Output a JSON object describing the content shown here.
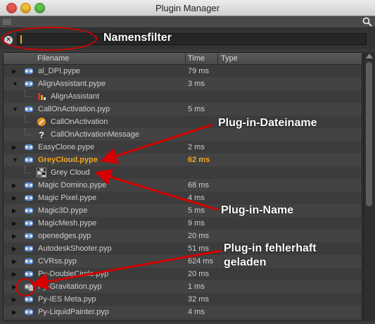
{
  "window": {
    "title": "Plugin Manager"
  },
  "filter": {
    "value": "",
    "placeholder": ""
  },
  "columns": {
    "filename": "Filename",
    "time": "Time",
    "type": "Type"
  },
  "rows": [
    {
      "name": "al_DPI.pype",
      "time": "79 ms",
      "level": 0,
      "expander": "collapsed",
      "icon": "python-file-icon"
    },
    {
      "name": "AlignAssistant.pype",
      "time": "3 ms",
      "level": 0,
      "expander": "expanded",
      "icon": "python-file-icon"
    },
    {
      "name": "AlignAssistant",
      "time": "",
      "level": 1,
      "expander": "none",
      "icon": "align-tool-icon"
    },
    {
      "name": "CallOnActivation.pyp",
      "time": "5 ms",
      "level": 0,
      "expander": "expanded",
      "icon": "python-file-icon"
    },
    {
      "name": "CallOnActivation",
      "time": "",
      "level": 1,
      "expander": "none",
      "icon": "plugin-pen-icon"
    },
    {
      "name": "CallOnActivationMessage",
      "time": "",
      "level": 1,
      "expander": "none",
      "icon": "question-mark-icon"
    },
    {
      "name": "EasyClone.pype",
      "time": "2 ms",
      "level": 0,
      "expander": "collapsed",
      "icon": "python-file-icon"
    },
    {
      "name": "GreyCloud.pype",
      "time": "62 ms",
      "level": 0,
      "expander": "expanded",
      "icon": "python-file-icon",
      "selected": true
    },
    {
      "name": "Grey Cloud",
      "time": "",
      "level": 1,
      "expander": "none",
      "icon": "noise-texture-icon"
    },
    {
      "name": "Magic Domino.pype",
      "time": "68 ms",
      "level": 0,
      "expander": "collapsed",
      "icon": "python-file-icon"
    },
    {
      "name": "Magic Pixel.pype",
      "time": "4 ms",
      "level": 0,
      "expander": "collapsed",
      "icon": "python-file-icon"
    },
    {
      "name": "Magic3D.pype",
      "time": "5 ms",
      "level": 0,
      "expander": "collapsed",
      "icon": "python-file-icon"
    },
    {
      "name": "MagicMesh.pype",
      "time": "9 ms",
      "level": 0,
      "expander": "collapsed",
      "icon": "python-file-icon"
    },
    {
      "name": "openedges.pyp",
      "time": "20 ms",
      "level": 0,
      "expander": "collapsed",
      "icon": "python-file-icon"
    },
    {
      "name": "AutodeskShooter.pyp",
      "time": "51 ms",
      "level": 0,
      "expander": "collapsed",
      "icon": "python-file-icon"
    },
    {
      "name": "CVRss.pyp",
      "time": "624 ms",
      "level": 0,
      "expander": "collapsed",
      "icon": "python-file-icon"
    },
    {
      "name": "Py-DoubleCircle.pyp",
      "time": "20 ms",
      "level": 0,
      "expander": "collapsed",
      "icon": "python-file-icon"
    },
    {
      "name": "Py-Gravitation.pyp",
      "time": "1 ms",
      "level": 0,
      "expander": "collapsed",
      "icon": "python-file-error-icon"
    },
    {
      "name": "Py-IES Meta.pyp",
      "time": "32 ms",
      "level": 0,
      "expander": "collapsed",
      "icon": "python-file-icon"
    },
    {
      "name": "Py-LiquidPainter.pyp",
      "time": "4 ms",
      "level": 0,
      "expander": "collapsed",
      "icon": "python-file-icon"
    }
  ],
  "annotations": {
    "name_filter": "Namensfilter",
    "plugin_filename": "Plug-in-Dateiname",
    "plugin_name": "Plug-in-Name",
    "plugin_error_line1": "Plug-in fehlerhaft",
    "plugin_error_line2": "geladen"
  },
  "colors": {
    "selected_text": "#f2a51c",
    "annotation_red": "#d40000"
  }
}
